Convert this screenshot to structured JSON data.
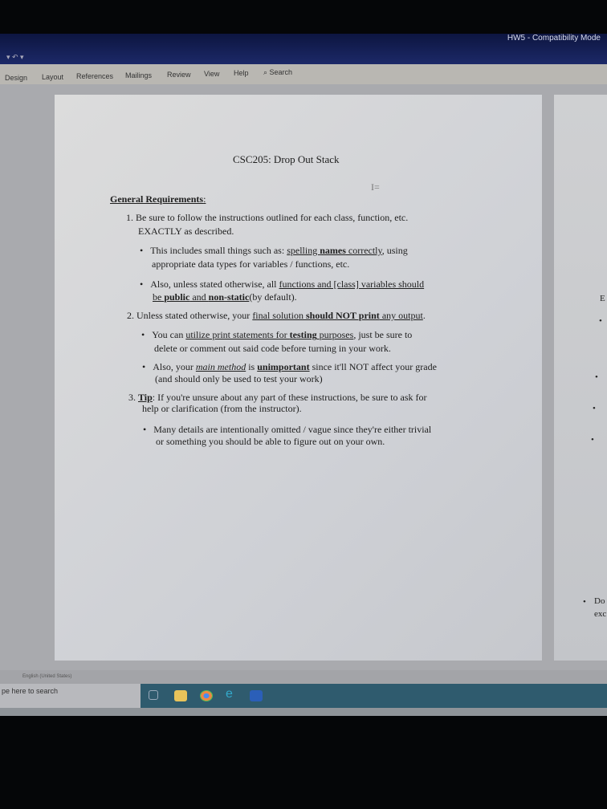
{
  "window": {
    "title": "HW5  -  Compatibility Mode"
  },
  "ribbon": {
    "tabs": [
      "Design",
      "Layout",
      "References",
      "Mailings",
      "Review",
      "View",
      "Help"
    ],
    "search_label": "Search"
  },
  "document": {
    "title": "CSC205: Drop Out Stack",
    "heading": "General Requirements",
    "heading_suffix": ":",
    "item1": {
      "num": "1.",
      "l1": "Be sure to follow the instructions outlined for each class, function, etc.",
      "l2": "EXACTLY as described."
    },
    "b1a": {
      "t1": "This includes small things such as: ",
      "u1": "spelling ",
      "b1": "names",
      "u2": " correctly",
      "t2": ", using",
      "l2": "appropriate data types for variables / functions, etc."
    },
    "b1b": {
      "t1": "Also, unless stated otherwise, all ",
      "u1": "functions and [class] variables should",
      "u2": "be ",
      "b1": "public",
      "u3": " and ",
      "b2": "non-static",
      "t2": " (by default)."
    },
    "item2": {
      "num": "2.",
      "t1": "Unless stated otherwise, your ",
      "u1": "final solution ",
      "b1": "should NOT print",
      "u2": " any output",
      "t2": "."
    },
    "b2a": {
      "t1": "You can ",
      "u1": "utilize print statements for ",
      "b1": "testing",
      "u2": " purposes",
      "t2": ", just be sure to",
      "l2": "delete or comment out said code before turning in your work."
    },
    "b2b": {
      "t1": "Also, your ",
      "i1": "main method",
      "t2": " is ",
      "b1": "unimportant",
      "t3": " since it'll NOT affect your grade",
      "l2": "(and should only be used to test your work)"
    },
    "item3": {
      "num": "3.",
      "b1": "Tip",
      "t1": ": If you're unsure about any part of these instructions, be sure to ask for",
      "l2": "help or clarification (from the instructor)."
    },
    "b3a": {
      "l1": "Many details are intentionally omitted / vague since they're either trivial",
      "l2": "or something you should be able to figure out on your own."
    },
    "next_page": {
      "e": "E",
      "bullet_text": "Do",
      "bullet_text2": "exc"
    }
  },
  "statusbar": {
    "language": "English (United States)"
  },
  "taskbar": {
    "search_placeholder": "pe here to search"
  },
  "colors": {
    "title_bar": "#1d2a6a",
    "taskbar": "#2f5b6e",
    "page": "#d6d7da"
  }
}
